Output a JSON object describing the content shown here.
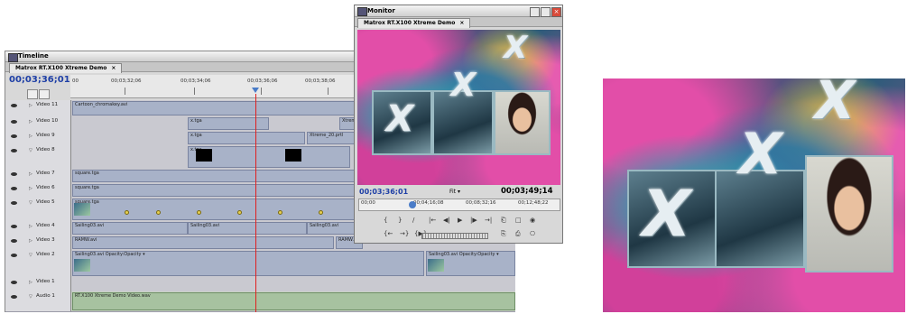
{
  "timeline": {
    "title": "Timeline",
    "tab_label": "Matrox RT.X100 Xtreme Demo",
    "tab_close": "×",
    "timecode": "00;03;36;01",
    "ruler_labels": [
      "00",
      "00;03;32;06",
      "00;03;34;06",
      "00;03;36;06",
      "00;03;38;06"
    ],
    "tracks": [
      {
        "name": "Video 11",
        "clips": [
          {
            "label": "Cartoon_chromakey.avi"
          }
        ]
      },
      {
        "name": "Video 10",
        "clips": [
          {
            "label": "x.tga"
          },
          {
            "label": "Xtreme"
          }
        ]
      },
      {
        "name": "Video 9",
        "clips": [
          {
            "label": "x.tga"
          },
          {
            "label": "Xtreme_20.prtl"
          }
        ]
      },
      {
        "name": "Video 8",
        "clips": [
          {
            "label": "x.tga"
          }
        ]
      },
      {
        "name": "Video 7",
        "clips": [
          {
            "label": "square.tga"
          }
        ]
      },
      {
        "name": "Video 6",
        "clips": [
          {
            "label": "square.tga"
          }
        ]
      },
      {
        "name": "Video 5",
        "clips": [
          {
            "label": "square.tga"
          }
        ]
      },
      {
        "name": "Video 4",
        "clips": [
          {
            "label": "Sailing03.avi"
          },
          {
            "label": "Sailing03.avi"
          },
          {
            "label": "Sailing03.avi"
          }
        ]
      },
      {
        "name": "Video 3",
        "clips": [
          {
            "label": "RAMW.avi"
          },
          {
            "label": "RAMW.a"
          }
        ]
      },
      {
        "name": "Video 2",
        "clips": [
          {
            "label": "Sailing03.avi Opacity:Opacity ▾"
          },
          {
            "label": "Sailing03.avi Opacity:Opacity ▾"
          }
        ]
      },
      {
        "name": "Video 1",
        "clips": []
      },
      {
        "name": "Audio 1",
        "clips": [
          {
            "label": "RT.X100 Xtreme Demo Video.wav"
          }
        ]
      }
    ]
  },
  "monitor": {
    "title": "Monitor",
    "tab_label": "Matrox RT.X100 Xtreme Demo",
    "tab_close": "×",
    "timecode_current": "00;03;36;01",
    "fit": "Fit",
    "timecode_duration": "00;03;49;14",
    "ruler_labels": [
      "00;00",
      "00;04;16;08",
      "00;08;32;16",
      "00;12;48;22"
    ],
    "controls_row1": [
      "{",
      "}",
      "/",
      "|←",
      "◀|",
      "▶",
      "|▶",
      "→|",
      "⎗",
      "□",
      "◉"
    ],
    "controls_row2": [
      "{←",
      "→}",
      "{▶}",
      "⎘",
      "⎙",
      "⎔"
    ]
  },
  "preview": {
    "x_glyph": "X"
  },
  "colors": {
    "timecode_blue": "#1e3fa6",
    "playhead_red": "#e02020"
  }
}
